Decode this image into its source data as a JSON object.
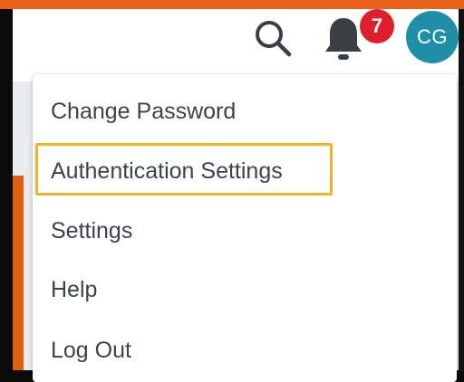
{
  "header": {
    "icons": {
      "search": "search-icon",
      "notifications": "bell-icon"
    },
    "notification_count": "7",
    "avatar_initials": "CG"
  },
  "user_menu": {
    "items": [
      {
        "label": "Change Password"
      },
      {
        "label": "Authentication Settings",
        "highlighted": true
      },
      {
        "label": "Settings"
      },
      {
        "label": "Help"
      },
      {
        "label": "Log Out"
      }
    ]
  },
  "colors": {
    "accent_orange": "#e8621c",
    "badge_red": "#e01f2c",
    "avatar_teal": "#1f8fa8",
    "highlight_yellow": "#f0b429"
  }
}
